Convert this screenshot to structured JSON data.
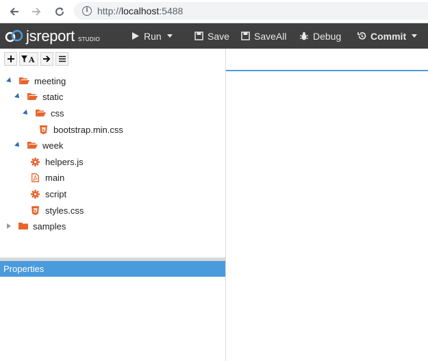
{
  "browser": {
    "url_protocol": "http://",
    "url_host": "localhost",
    "url_port": ":5488"
  },
  "app": {
    "logo_text": "jsreport",
    "logo_sub": "STUDIO",
    "toolbar": {
      "run": "Run",
      "save": "Save",
      "save_all": "SaveAll",
      "debug": "Debug",
      "commit": "Commit"
    }
  },
  "tree": {
    "items": [
      {
        "label": "meeting",
        "icon": "folder-open-icon",
        "expanded": true
      },
      {
        "label": "static",
        "icon": "folder-open-icon",
        "expanded": true
      },
      {
        "label": "css",
        "icon": "folder-open-icon",
        "expanded": true
      },
      {
        "label": "bootstrap.min.css",
        "icon": "css3-icon"
      },
      {
        "label": "week",
        "icon": "folder-open-icon",
        "expanded": true
      },
      {
        "label": "helpers.js",
        "icon": "cog-icon"
      },
      {
        "label": "main",
        "icon": "pdf-file-icon"
      },
      {
        "label": "script",
        "icon": "cog-icon"
      },
      {
        "label": "styles.css",
        "icon": "css3-icon"
      },
      {
        "label": "samples",
        "icon": "folder-icon",
        "expanded": false
      }
    ]
  },
  "properties": {
    "title": "Properties"
  },
  "colors": {
    "accent": "#4a9ade",
    "toolbar_bg": "#3f3f3f",
    "icon_orange": "#e8642c"
  }
}
